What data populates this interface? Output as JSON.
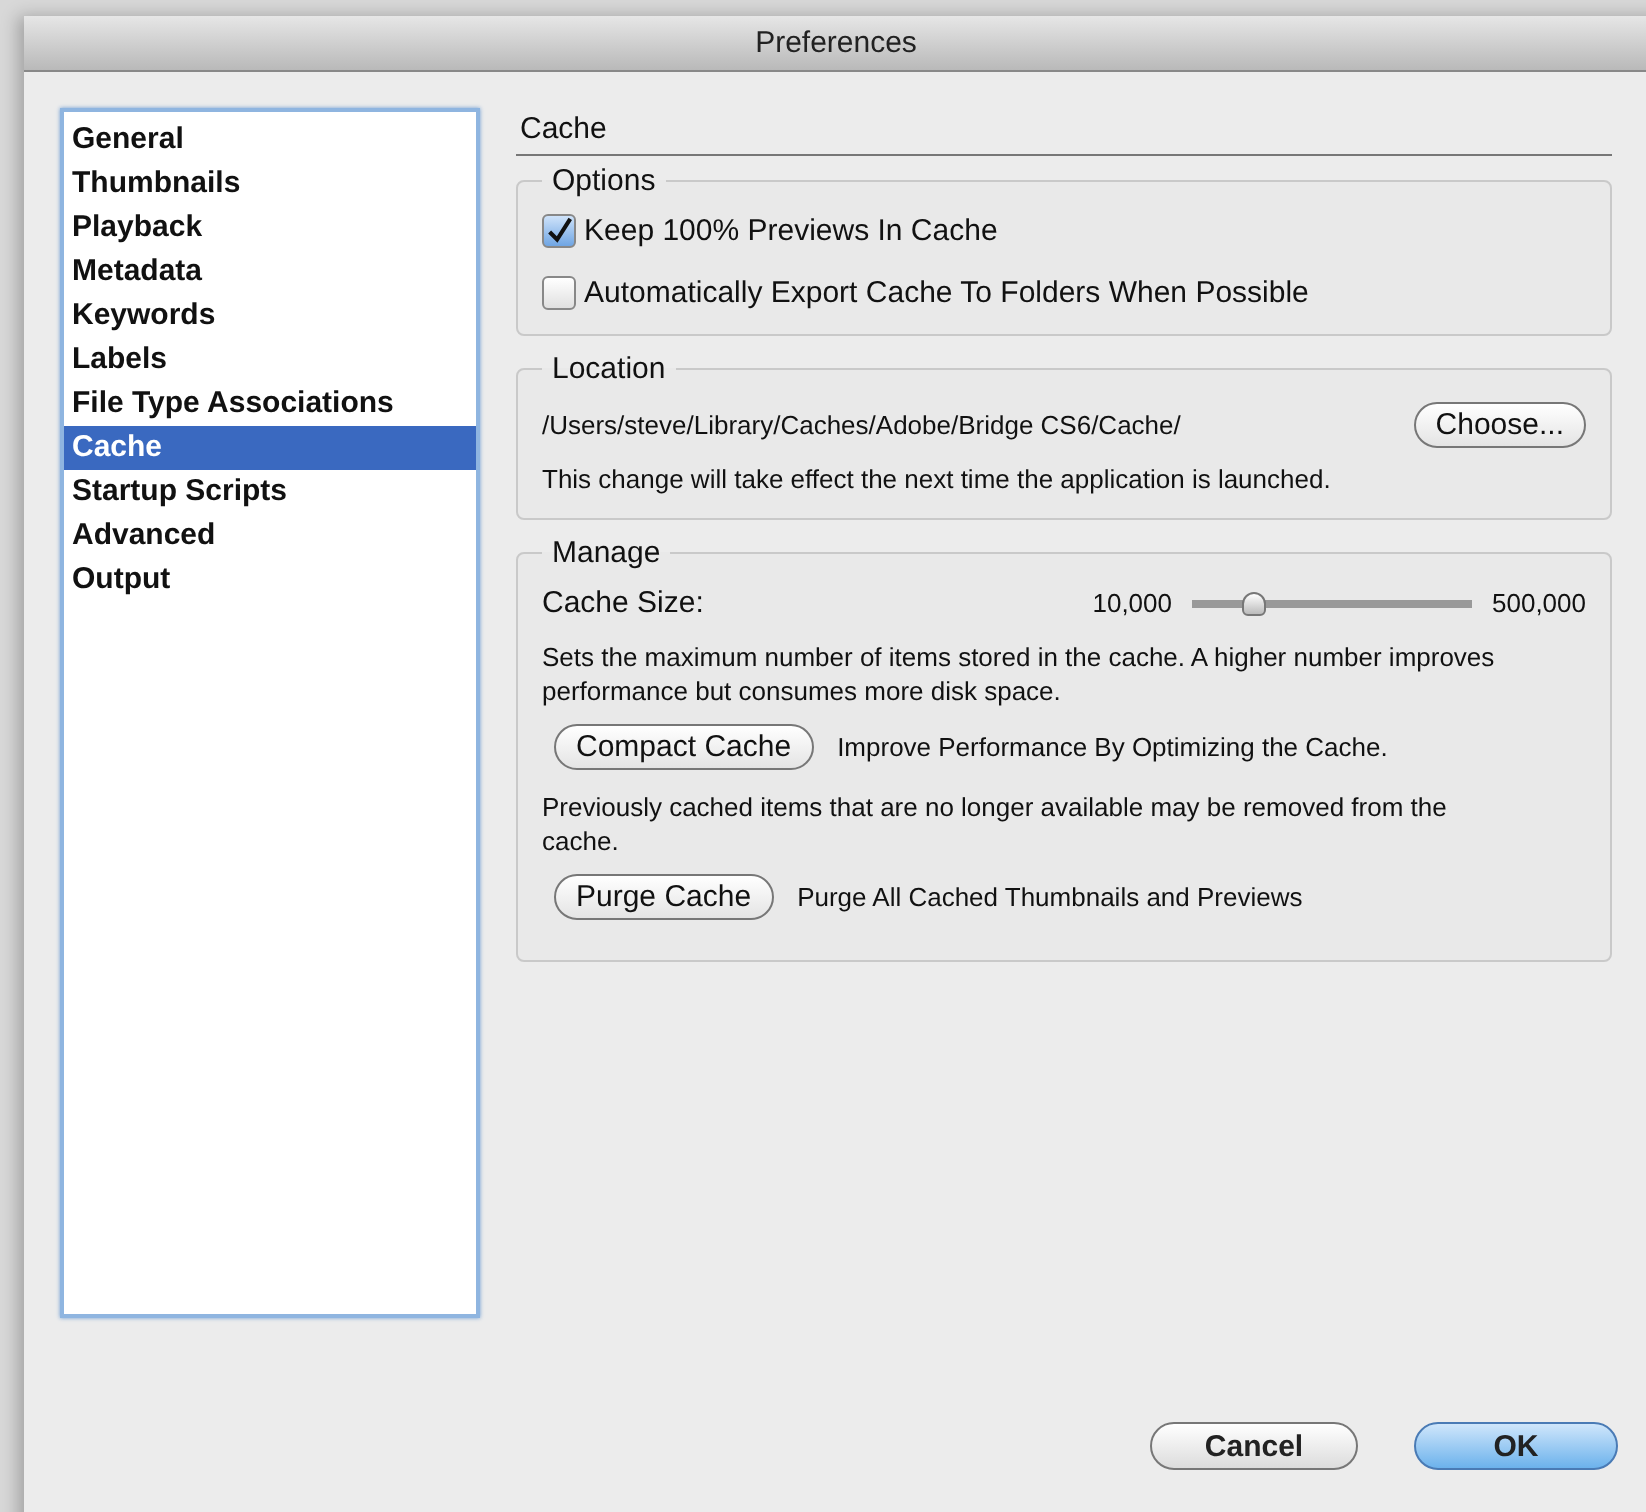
{
  "window": {
    "title": "Preferences"
  },
  "sidebar": {
    "items": [
      {
        "label": "General",
        "selected": false
      },
      {
        "label": "Thumbnails",
        "selected": false
      },
      {
        "label": "Playback",
        "selected": false
      },
      {
        "label": "Metadata",
        "selected": false
      },
      {
        "label": "Keywords",
        "selected": false
      },
      {
        "label": "Labels",
        "selected": false
      },
      {
        "label": "File Type Associations",
        "selected": false
      },
      {
        "label": "Cache",
        "selected": true
      },
      {
        "label": "Startup Scripts",
        "selected": false
      },
      {
        "label": "Advanced",
        "selected": false
      },
      {
        "label": "Output",
        "selected": false
      }
    ]
  },
  "page_title": "Cache",
  "options": {
    "title": "Options",
    "checkboxes": [
      {
        "label": "Keep 100% Previews In Cache",
        "checked": true
      },
      {
        "label": "Automatically Export Cache To Folders When Possible",
        "checked": false
      }
    ]
  },
  "location": {
    "title": "Location",
    "path": "/Users/steve/Library/Caches/Adobe/Bridge CS6/Cache/",
    "button": "Choose...",
    "note": "This change will take effect the next time the application is launched."
  },
  "manage": {
    "title": "Manage",
    "size_label": "Cache Size:",
    "slider": {
      "min_label": "10,000",
      "max_label": "500,000",
      "level": 0.22
    },
    "size_note": "Sets the maximum number of items stored in the cache. A higher number improves performance but consumes more disk space.",
    "compact": {
      "button": "Compact Cache",
      "description": "Improve Performance By Optimizing the Cache."
    },
    "compact_note": "Previously cached items that are no longer available may be removed from the cache.",
    "purge": {
      "button": "Purge Cache",
      "description": "Purge All Cached Thumbnails and Previews"
    }
  },
  "buttons": [
    {
      "label": "Cancel",
      "kind": "normal"
    },
    {
      "label": "OK",
      "kind": "default"
    }
  ]
}
